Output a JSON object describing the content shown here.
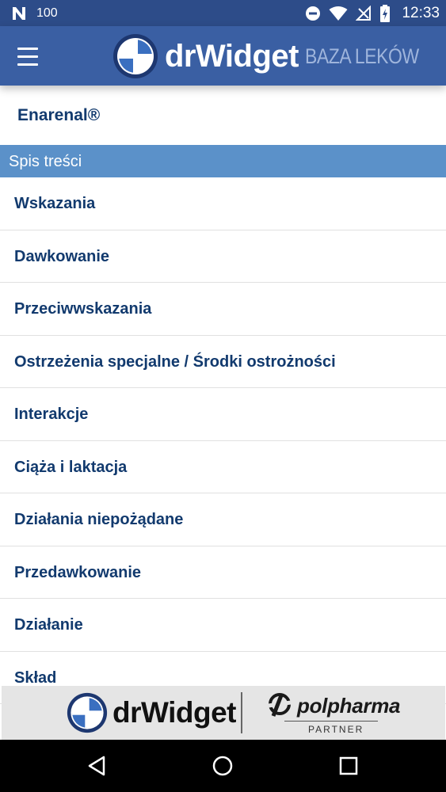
{
  "status_bar": {
    "battery_level": "100",
    "time": "12:33"
  },
  "app_bar": {
    "brand_name": "drWidget",
    "brand_subtitle": "BAZA LEKÓW"
  },
  "drug": {
    "title": "Enarenal®"
  },
  "toc": {
    "header": "Spis treści",
    "items": [
      {
        "label": "Wskazania"
      },
      {
        "label": "Dawkowanie"
      },
      {
        "label": "Przeciwwskazania"
      },
      {
        "label": "Ostrzeżenia specjalne / Środki ostrożności"
      },
      {
        "label": "Interakcje"
      },
      {
        "label": "Ciąża i laktacja"
      },
      {
        "label": "Działania niepożądane"
      },
      {
        "label": "Przedawkowanie"
      },
      {
        "label": "Działanie"
      },
      {
        "label": "Skład"
      }
    ]
  },
  "partner_banner": {
    "brand_name": "drWidget",
    "partner_name": "polpharma",
    "partner_label": "PARTNER"
  },
  "colors": {
    "status_bar": "#2d4c89",
    "app_bar": "#3a5fa3",
    "section_header": "#5b91c9",
    "item_text": "#123a6e",
    "divider": "#e1e1e1"
  }
}
